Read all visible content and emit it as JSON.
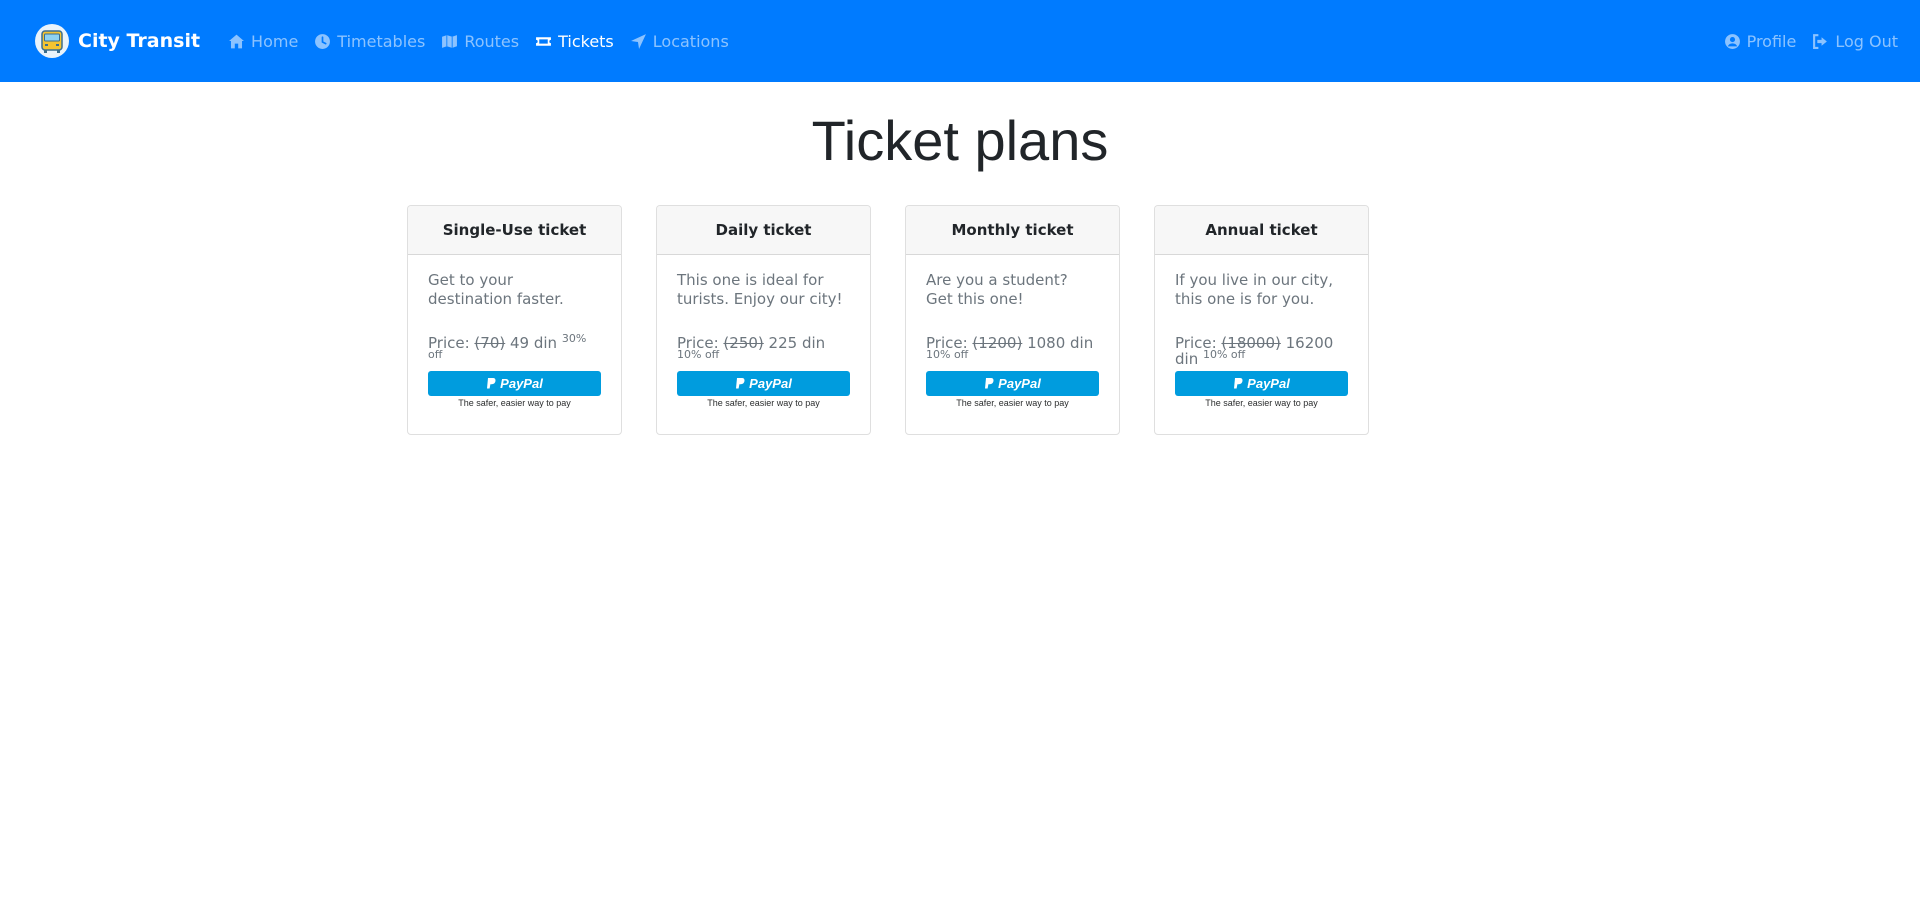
{
  "nav": {
    "brand": "City Transit",
    "links": [
      {
        "label": "Home",
        "icon": "home-icon"
      },
      {
        "label": "Timetables",
        "icon": "clock-icon"
      },
      {
        "label": "Routes",
        "icon": "map-icon"
      },
      {
        "label": "Tickets",
        "icon": "ticket-icon",
        "active": true
      },
      {
        "label": "Locations",
        "icon": "location-arrow-icon"
      }
    ],
    "right": [
      {
        "label": "Profile",
        "icon": "user-circle-icon"
      },
      {
        "label": "Log Out",
        "icon": "sign-out-icon"
      }
    ]
  },
  "page": {
    "title": "Ticket plans"
  },
  "cards": [
    {
      "name": "Single-Use ticket",
      "description": "Get to your destination faster.",
      "price_label": "Price: ",
      "old_price": "(70)",
      "new_price": "49 din",
      "discount": "30% off",
      "button_label": "PayPal",
      "tagline": "The safer, easier way to pay"
    },
    {
      "name": "Daily ticket",
      "description": "This one is ideal for turists. Enjoy our city!",
      "price_label": "Price: ",
      "old_price": "(250)",
      "new_price": "225 din",
      "discount": "10% off",
      "button_label": "PayPal",
      "tagline": "The safer, easier way to pay"
    },
    {
      "name": "Monthly ticket",
      "description": "Are you a student? Get this one!",
      "price_label": "Price: ",
      "old_price": "(1200)",
      "new_price": "1080 din",
      "discount": "10% off",
      "button_label": "PayPal",
      "tagline": "The safer, easier way to pay"
    },
    {
      "name": "Annual ticket",
      "description": "If you live in our city, this one is for you.",
      "price_label": "Price: ",
      "old_price": "(18000)",
      "new_price": "16200 din",
      "discount": "10% off",
      "button_label": "PayPal",
      "tagline": "The safer, easier way to pay"
    }
  ],
  "colors": {
    "navbar": "#007bff",
    "paypal": "#009cde",
    "card_header": "#f7f7f7",
    "muted_text": "#6c757d"
  }
}
